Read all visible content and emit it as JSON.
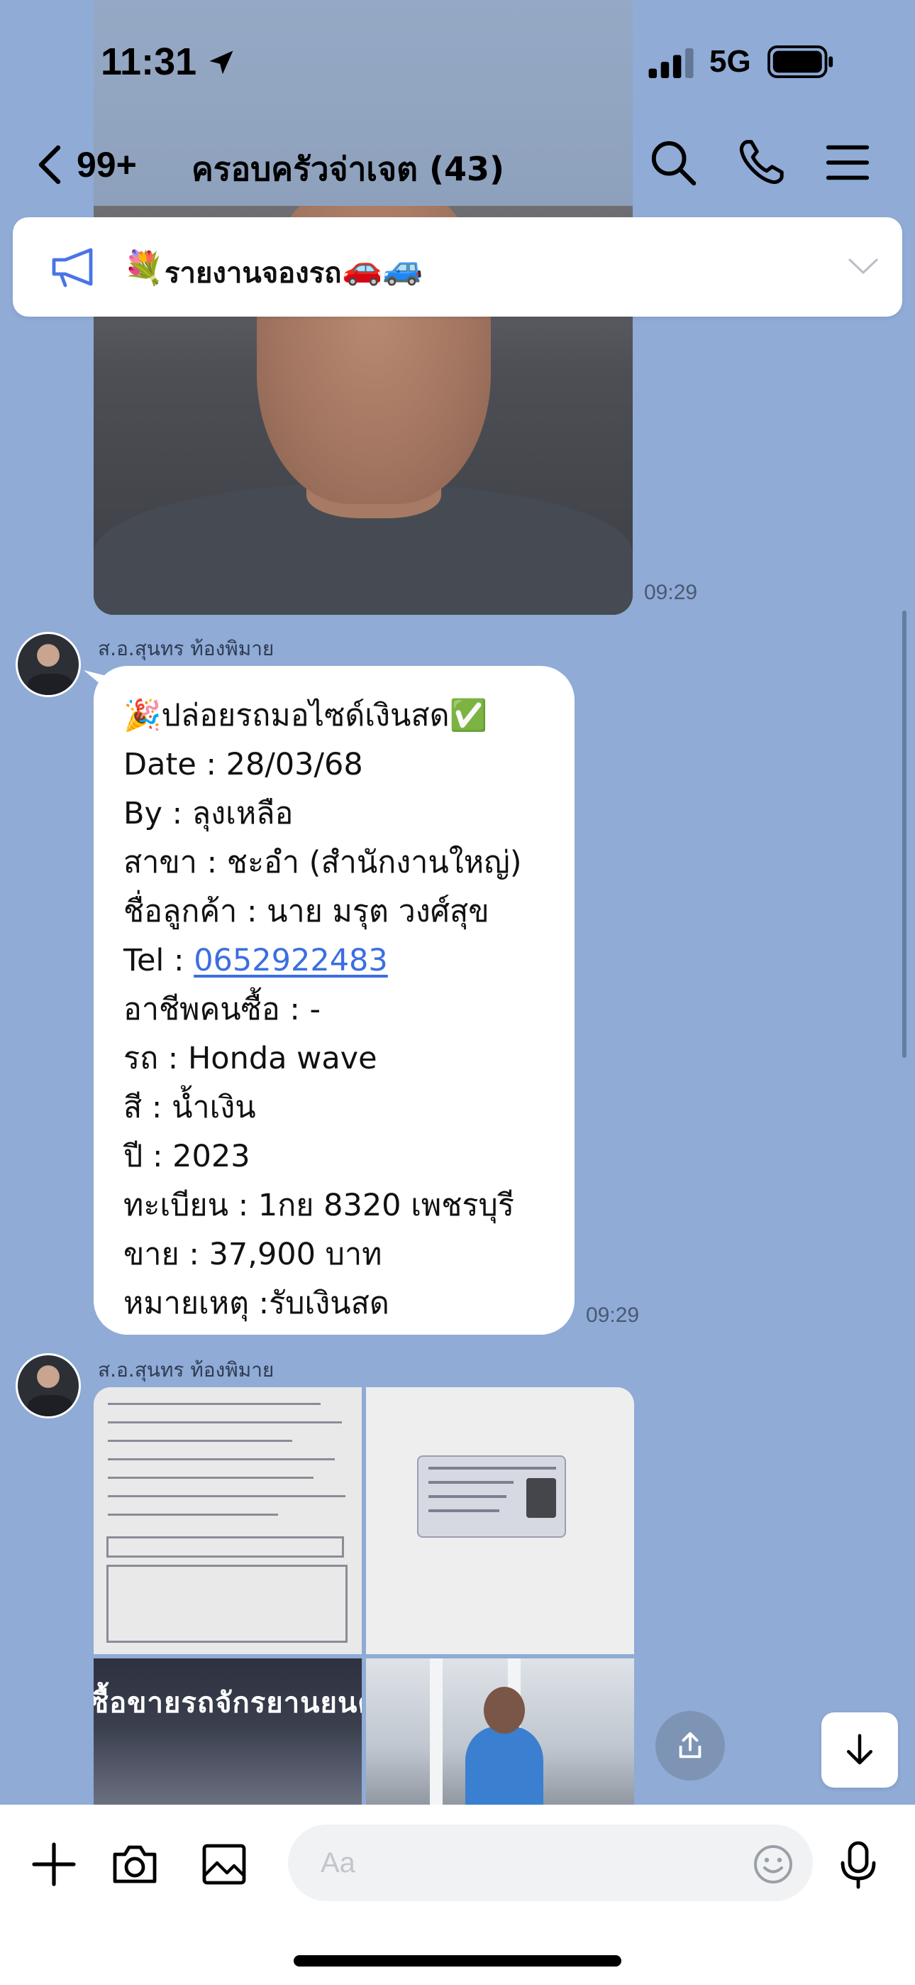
{
  "status_bar": {
    "time": "11:31",
    "network": "5G"
  },
  "header": {
    "back_count": "99+",
    "title": "ครอบครัวจ่าเจต (43)"
  },
  "announcement": {
    "emoji": "💐",
    "text": "รายงานจองรถ",
    "cars": "🚗🚙"
  },
  "messages": {
    "photo_time": "09:29",
    "sender_1": "ส.อ.สุนทร ท้องพิมาย",
    "bubble": {
      "header_emoji": "🎉",
      "header_text": "ปล่อยรถมอไซด์เงินสด",
      "header_check": "✅",
      "line_date": "Date : 28/03/68",
      "line_by": "By : ลุงเหลือ",
      "line_branch": "สาขา : ชะอำ (สำนักงานใหญ่)",
      "line_customer": "ชื่อลูกค้า : นาย มรุต วงศ์สุข",
      "tel_label": "Tel : ",
      "tel_value": "0652922483",
      "line_job": "อาชีพคนซื้อ : -",
      "line_bike": "รถ : Honda  wave",
      "line_color": "สี : น้ำเงิน",
      "line_year": "ปี : 2023",
      "line_plate": "ทะเบียน : 1กย 8320 เพชรบุรี",
      "line_price": "ขาย : 37,900 บาท",
      "line_note": "หมายเหตุ :รับเงินสด"
    },
    "bubble_time": "09:29",
    "sender_2": "ส.อ.สุนทร ท้องพิมาย",
    "shop_sign_text": "ซื้อขายรถจักรยานยนต์"
  },
  "input": {
    "placeholder": "Aa"
  },
  "colors": {
    "chat_background": "#8fabd6",
    "link": "#3b6ee0",
    "announcement_icon": "#4a74e8"
  },
  "icons": [
    "location-arrow-icon",
    "signal-icon",
    "battery-icon",
    "back-chevron-icon",
    "search-icon",
    "phone-icon",
    "menu-icon",
    "megaphone-icon",
    "chevron-down-icon",
    "share-icon",
    "arrow-down-icon",
    "plus-icon",
    "camera-icon",
    "image-icon",
    "emoji-icon",
    "microphone-icon"
  ]
}
